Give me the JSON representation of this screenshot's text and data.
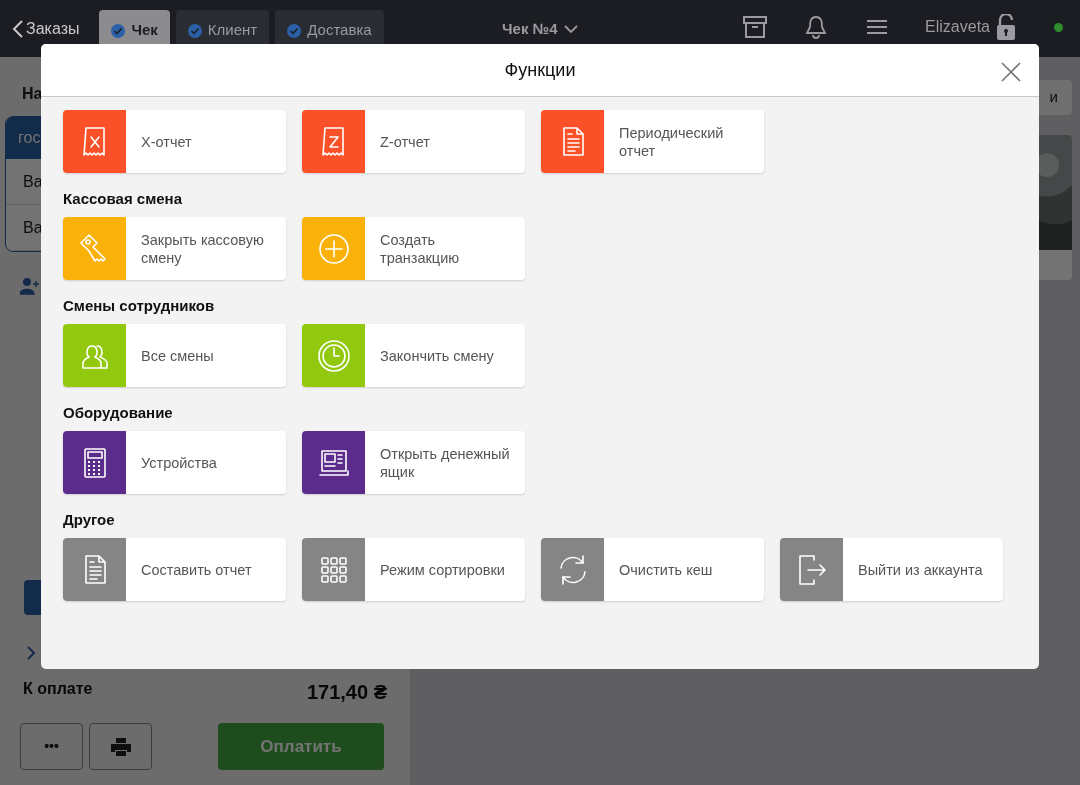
{
  "top_bar": {
    "back": "Заказы",
    "tabs": [
      {
        "label": "Чек",
        "selected": true,
        "checked": true
      },
      {
        "label": "Клиент",
        "selected": false,
        "checked": true
      },
      {
        "label": "Доставка",
        "selected": false,
        "checked": true
      }
    ],
    "title": "Чек №4",
    "user": "Elizaveta",
    "status_dot": {
      "color": "#2e8b2e"
    }
  },
  "order_panel": {
    "heading": "На",
    "card_header": "гос",
    "rows": [
      "Ва",
      "Ва"
    ],
    "total_label": "К оплате",
    "total": "171,40 ₴",
    "more_button": "•••",
    "pay_button": "Оплатить"
  },
  "right_panel": {
    "button": "и"
  },
  "modal": {
    "title": "Функции",
    "sections": [
      {
        "color": "#fa5128",
        "items": [
          {
            "label": "X-отчет"
          },
          {
            "label": "Z-отчет"
          },
          {
            "label": "Периодический отчет"
          }
        ]
      },
      {
        "title": "Кассовая смена",
        "color": "#fab20a",
        "items": [
          {
            "label": "Закрыть кассовую смену"
          },
          {
            "label": "Создать транзакцию"
          }
        ]
      },
      {
        "title": "Смены сотрудников",
        "color": "#92c80e",
        "items": [
          {
            "label": "Все смены"
          },
          {
            "label": "Закончить смену"
          }
        ]
      },
      {
        "title": "Оборудование",
        "color": "#5b2c8c",
        "items": [
          {
            "label": "Устройства"
          },
          {
            "label": "Открыть денежный ящик"
          }
        ]
      },
      {
        "title": "Другое",
        "color": "#858585",
        "items": [
          {
            "label": "Составить отчет"
          },
          {
            "label": "Режим сортировки"
          },
          {
            "label": "Очистить кеш"
          },
          {
            "label": "Выйти из аккаунта"
          }
        ]
      }
    ]
  }
}
